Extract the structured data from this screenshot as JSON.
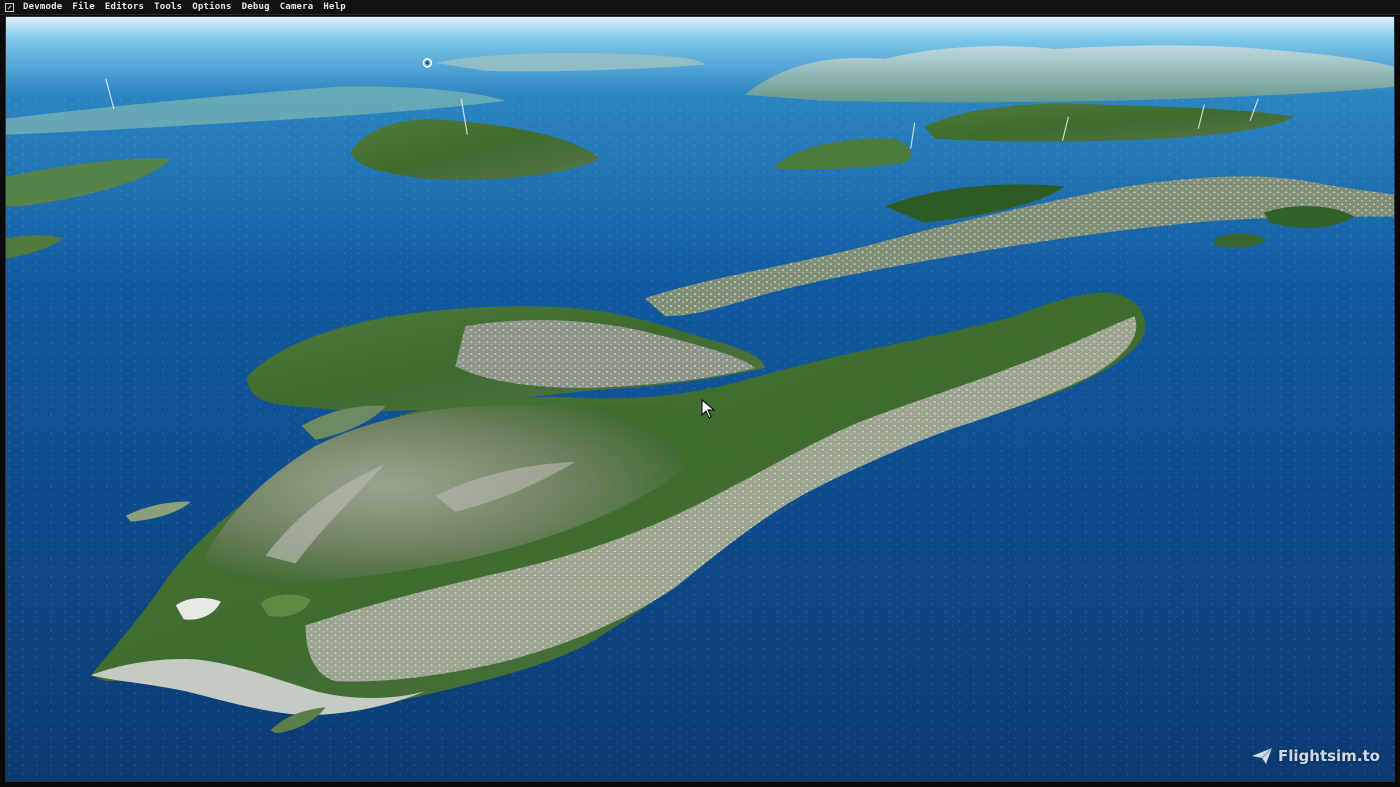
{
  "menubar": {
    "items": [
      "Devmode",
      "File",
      "Editors",
      "Tools",
      "Options",
      "Debug",
      "Camera",
      "Help"
    ]
  },
  "icons": {
    "devmode": "devmode-icon",
    "cursor": "mouse-pointer-icon",
    "watermark": "paper-plane-icon"
  },
  "watermark": {
    "text": "Flightsim.to"
  },
  "colors": {
    "sea_deep": "#0b3a72",
    "sea_light": "#2c86c2",
    "sky": "#dff1fb",
    "land_green": "#3e6b2e",
    "rock": "#8e9a86",
    "town": "#c9ccc8"
  }
}
